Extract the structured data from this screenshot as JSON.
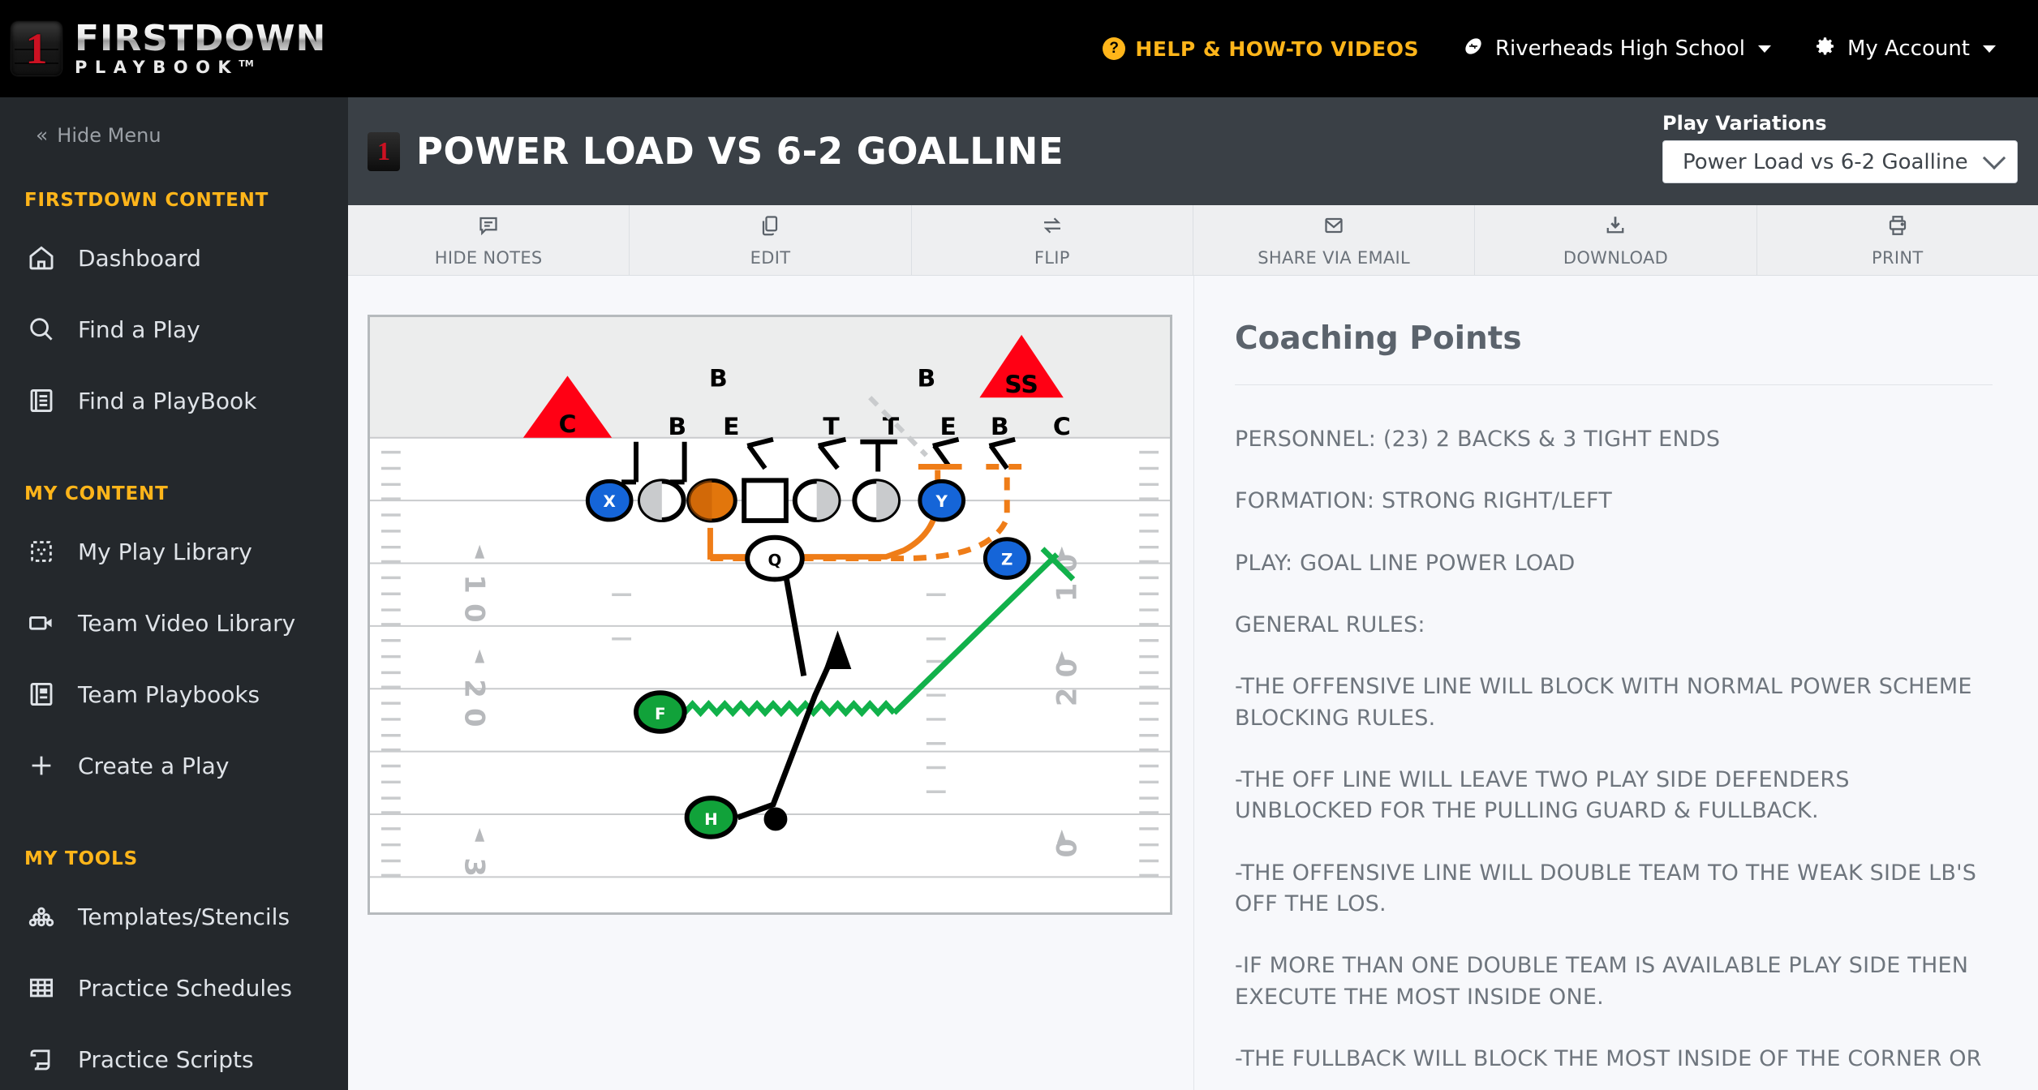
{
  "brand": {
    "badge_number": "1",
    "name_top": "FIRSTDOWN",
    "name_bottom": "PLAYBOOK",
    "trademark": "TM"
  },
  "topnav": {
    "help_label": "HELP  & HOW-TO VIDEOS",
    "help_icon_glyph": "?",
    "school_label": "Riverheads High School",
    "school_icon": "football-icon",
    "account_label": "My Account",
    "account_icon": "gear-icon"
  },
  "sidebar": {
    "hide_menu": "Hide Menu",
    "sections": [
      {
        "title": "FIRSTDOWN CONTENT",
        "items": [
          {
            "label": "Dashboard",
            "icon": "home-icon"
          },
          {
            "label": "Find a Play",
            "icon": "search-icon"
          },
          {
            "label": "Find a PlayBook",
            "icon": "book-icon"
          }
        ]
      },
      {
        "title": "MY CONTENT",
        "items": [
          {
            "label": "My Play Library",
            "icon": "play-grid-icon"
          },
          {
            "label": "Team Video Library",
            "icon": "video-camera-icon"
          },
          {
            "label": "Team Playbooks",
            "icon": "book-open-icon"
          },
          {
            "label": "Create a Play",
            "icon": "plus-icon"
          }
        ]
      },
      {
        "title": "MY TOOLS",
        "items": [
          {
            "label": "Templates/Stencils",
            "icon": "stencil-dots-icon"
          },
          {
            "label": "Practice Schedules",
            "icon": "table-grid-icon"
          },
          {
            "label": "Practice Scripts",
            "icon": "scroll-icon"
          }
        ]
      }
    ]
  },
  "play_header": {
    "badge_number": "1",
    "title": "POWER LOAD VS 6-2 GOALLINE",
    "variations_label": "Play Variations",
    "variations_value": "Power Load vs 6-2 Goalline"
  },
  "toolbar": {
    "buttons": [
      {
        "label": "HIDE NOTES",
        "icon": "notes-icon"
      },
      {
        "label": "EDIT",
        "icon": "copy-icon"
      },
      {
        "label": "FLIP",
        "icon": "swap-arrows-icon"
      },
      {
        "label": "SHARE VIA EMAIL",
        "icon": "envelope-icon"
      },
      {
        "label": "DOWNLOAD",
        "icon": "download-icon"
      },
      {
        "label": "PRINT",
        "icon": "printer-icon"
      }
    ]
  },
  "notes": {
    "title": "Coaching Points",
    "paragraphs": [
      "PERSONNEL: (23) 2 BACKS & 3 TIGHT ENDS",
      "FORMATION: STRONG RIGHT/LEFT",
      "PLAY: GOAL LINE POWER LOAD",
      "GENERAL RULES:",
      "-THE OFFENSIVE LINE WILL BLOCK WITH NORMAL POWER SCHEME BLOCKING RULES.",
      "-THE OFF LINE WILL LEAVE TWO PLAY SIDE DEFENDERS UNBLOCKED FOR THE PULLING GUARD & FULLBACK.",
      "-THE OFFENSIVE LINE WILL DOUBLE TEAM TO THE WEAK SIDE LB'S OFF THE LOS.",
      "-IF MORE THAN ONE DOUBLE TEAM IS AVAILABLE PLAY SIDE THEN EXECUTE THE MOST INSIDE ONE.",
      "-THE FULLBACK WILL BLOCK THE MOST INSIDE OF THE CORNER OR"
    ]
  },
  "play_diagram": {
    "defense_top_labels": [
      "B",
      "B"
    ],
    "defense_line_labels": [
      "B",
      "E",
      "T",
      "T",
      "E",
      "B",
      "C"
    ],
    "defense_triangles": [
      {
        "label": "C"
      },
      {
        "label": "SS"
      }
    ],
    "offense_players": [
      {
        "label": "X",
        "color": "#1565d8",
        "shape": "ellipse"
      },
      {
        "label": "",
        "color": "#c9cbcd",
        "shape": "split-ellipse"
      },
      {
        "label": "",
        "color": "#e2760c",
        "shape": "ellipse"
      },
      {
        "label": "",
        "color": "#ffffff",
        "shape": "square"
      },
      {
        "label": "",
        "color": "#c9cbcd",
        "shape": "split-ellipse"
      },
      {
        "label": "",
        "color": "#c9cbcd",
        "shape": "split-ellipse"
      },
      {
        "label": "Y",
        "color": "#1565d8",
        "shape": "ellipse"
      },
      {
        "label": "Z",
        "color": "#1565d8",
        "shape": "ellipse"
      },
      {
        "label": "Q",
        "color": "#ffffff",
        "shape": "ellipse"
      },
      {
        "label": "F",
        "color": "#11a23a",
        "shape": "ellipse"
      },
      {
        "label": "H",
        "color": "#11a23a",
        "shape": "ellipse"
      }
    ],
    "yard_numbers_left": [
      "10",
      "20",
      "3"
    ],
    "yard_numbers_right": [
      "10",
      "20",
      "0"
    ],
    "route_colors": {
      "pull": "#ef7d18",
      "motion": "#11b14a",
      "block": "#000000",
      "stunt": "#c9cbcd"
    }
  }
}
